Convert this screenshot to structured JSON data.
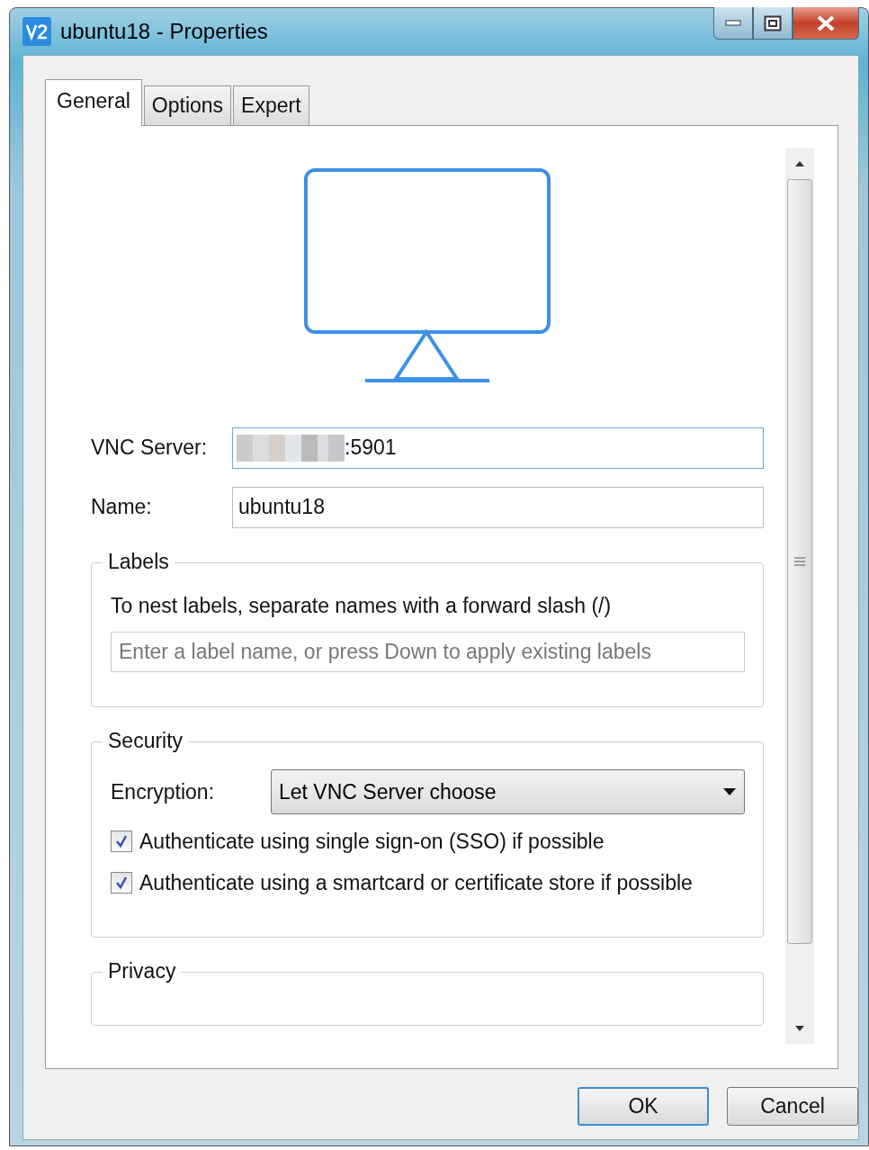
{
  "window": {
    "title": "ubuntu18 - Properties"
  },
  "tabs": [
    {
      "label": "General",
      "selected": true
    },
    {
      "label": "Options",
      "selected": false
    },
    {
      "label": "Expert",
      "selected": false
    }
  ],
  "fields": [
    {
      "label": "VNC Server:",
      "value": ":5901",
      "obscured": true,
      "focused": true
    },
    {
      "label": "Name:",
      "value": "ubuntu18",
      "obscured": false,
      "focused": false
    }
  ],
  "labels_group": {
    "title": "Labels",
    "hint": "To nest labels, separate names with a forward slash (/)",
    "placeholder": "Enter a label name, or press Down to apply existing labels"
  },
  "security_group": {
    "title": "Security",
    "encryption": {
      "label": "Encryption:",
      "value": "Let VNC Server choose"
    },
    "checkboxes": [
      {
        "label": "Authenticate using single sign-on (SSO) if possible",
        "checked": true
      },
      {
        "label": "Authenticate using a smartcard or certificate store if possible",
        "checked": true
      }
    ]
  },
  "privacy_group": {
    "title": "Privacy"
  },
  "buttons": [
    {
      "label": "OK",
      "default": true
    },
    {
      "label": "Cancel",
      "default": false
    }
  ]
}
